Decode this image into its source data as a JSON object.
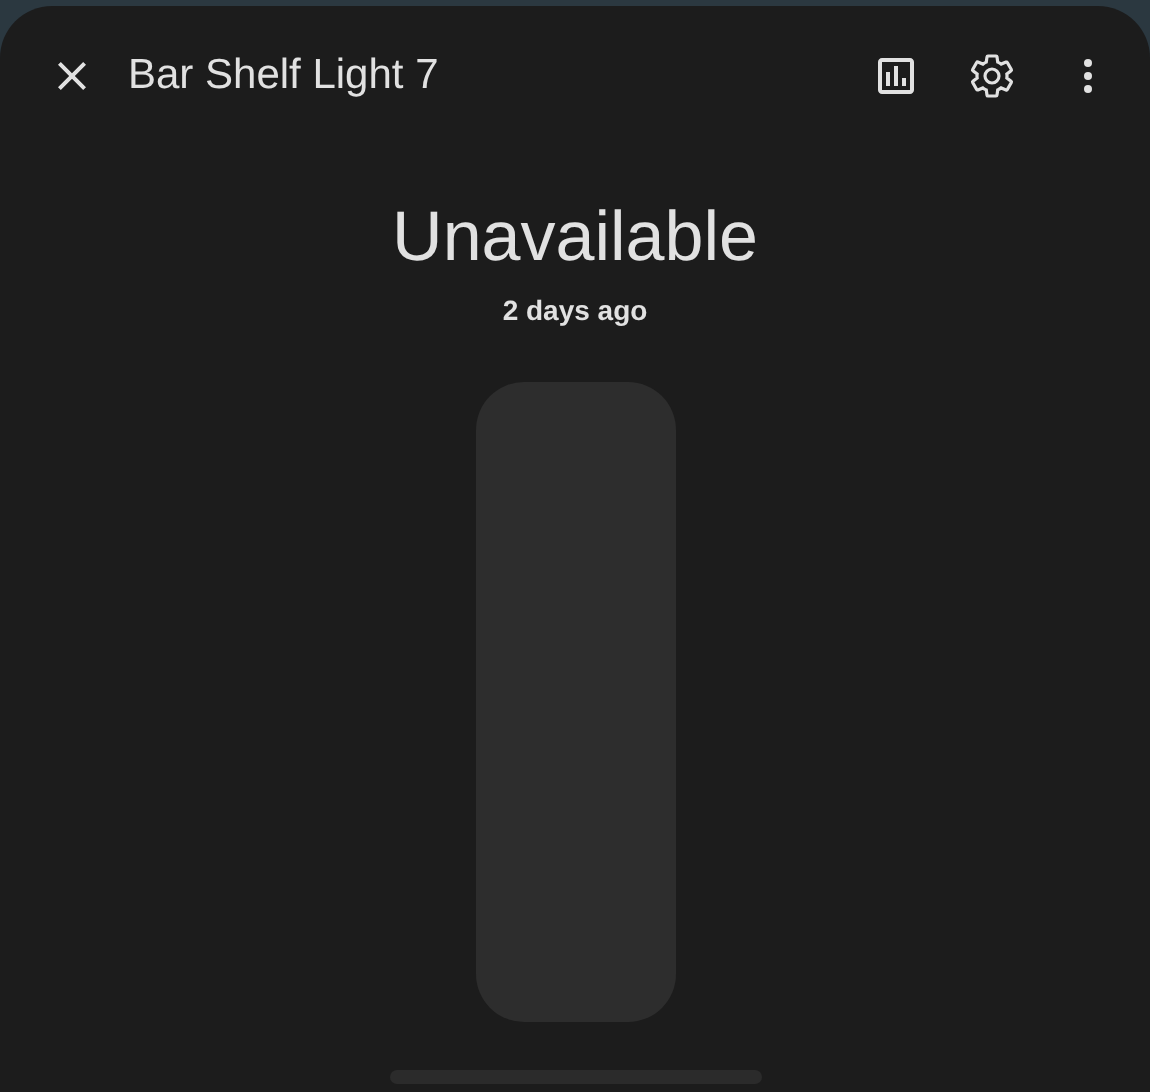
{
  "dialog": {
    "title": "Bar Shelf Light 7"
  },
  "state": {
    "label": "Unavailable",
    "last_changed": "2 days ago"
  }
}
